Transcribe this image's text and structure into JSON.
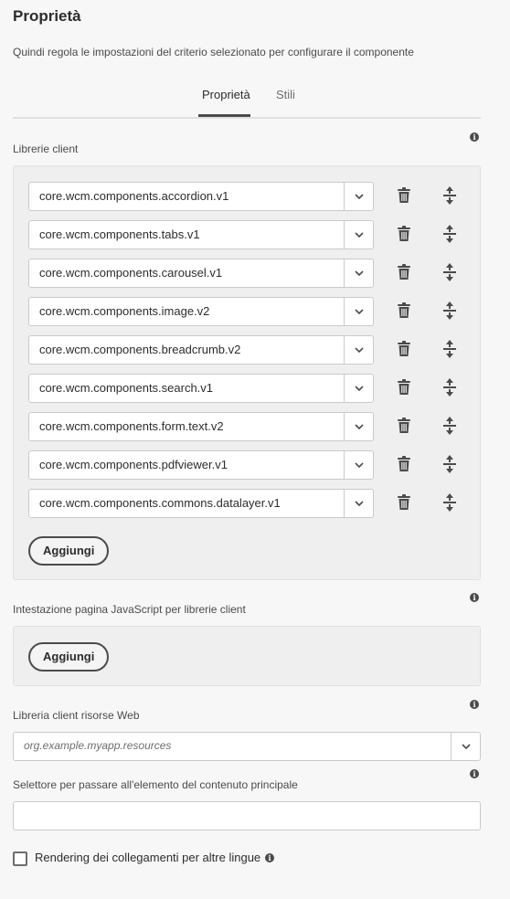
{
  "header": {
    "title": "Proprietà",
    "subtitle": "Quindi regola le impostazioni del criterio selezionato per configurare il componente"
  },
  "tabs": [
    {
      "label": "Proprietà",
      "active": true
    },
    {
      "label": "Stili",
      "active": false
    }
  ],
  "client_libs": {
    "label": "Librerie client",
    "items": [
      "core.wcm.components.accordion.v1",
      "core.wcm.components.tabs.v1",
      "core.wcm.components.carousel.v1",
      "core.wcm.components.image.v2",
      "core.wcm.components.breadcrumb.v2",
      "core.wcm.components.search.v1",
      "core.wcm.components.form.text.v2",
      "core.wcm.components.pdfviewer.v1",
      "core.wcm.components.commons.datalayer.v1"
    ],
    "add_label": "Aggiungi"
  },
  "js_head_libs": {
    "label": "Intestazione pagina JavaScript per librerie client",
    "add_label": "Aggiungi"
  },
  "web_resources": {
    "label": "Libreria client risorse Web",
    "placeholder": "org.example.myapp.resources"
  },
  "main_selector": {
    "label": "Selettore per passare all'elemento del contenuto principale",
    "value": ""
  },
  "alternate_links": {
    "label": "Rendering dei collegamenti per altre lingue",
    "checked": false
  },
  "icons": {
    "info": "info-icon",
    "chevron": "chevron-down-icon",
    "trash": "trash-icon",
    "drag": "drag-handle-icon"
  }
}
